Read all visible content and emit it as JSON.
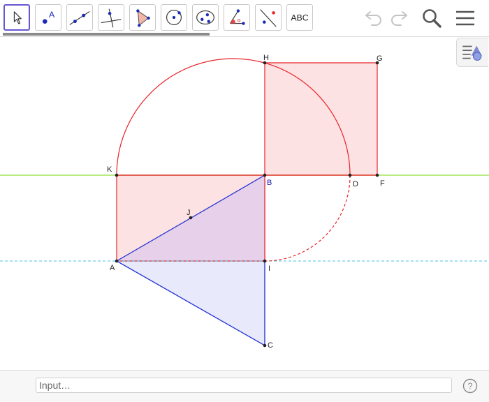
{
  "toolbar": {
    "tools": [
      {
        "name": "move-tool",
        "active": true
      },
      {
        "name": "point-tool"
      },
      {
        "name": "line-tool"
      },
      {
        "name": "perpendicular-line-tool"
      },
      {
        "name": "polygon-tool"
      },
      {
        "name": "circle-tool"
      },
      {
        "name": "conic-tool"
      },
      {
        "name": "angle-tool"
      },
      {
        "name": "reflect-tool"
      },
      {
        "name": "text-tool",
        "label": "ABC"
      }
    ],
    "point_tool_letter": "A"
  },
  "header_icons": [
    "undo-icon",
    "redo-icon",
    "search-icon",
    "menu-icon"
  ],
  "diagram": {
    "points": {
      "A": "A",
      "B": "B",
      "C": "C",
      "D": "D",
      "F": "F",
      "G": "G",
      "H": "H",
      "I": "I",
      "J": "J",
      "K": "K"
    },
    "colors": {
      "red": "#e8252a",
      "red_fill": "#fde2e3",
      "blue": "#2333d3",
      "blue_fill": "#e4e6fb",
      "purple_fill": "#e7d0e9",
      "green": "#8fe23a",
      "cyan_dashed": "#47c0e8"
    }
  },
  "input": {
    "placeholder": "Input…"
  },
  "help_symbol": "?"
}
